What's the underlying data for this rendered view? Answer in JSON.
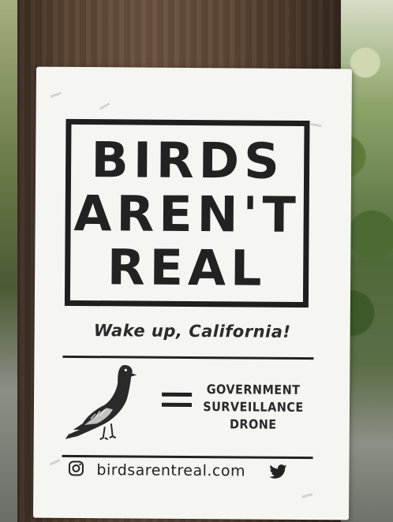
{
  "poster": {
    "title_line1": "BIRDS",
    "title_line2": "AREN'T",
    "title_line3": "REAL",
    "tagline": "Wake up, California!",
    "label_line1": "GOVERNMENT",
    "label_line2": "SURVEILLANCE",
    "label_line3": "DRONE",
    "website": "birdsarentreal.com",
    "icons": [
      "pigeon-illustration",
      "equals-icon",
      "instagram-icon",
      "twitter-icon"
    ]
  },
  "colors": {
    "ink": "#222222",
    "paper": "#f5f5f2",
    "pole": "#5e4736"
  }
}
